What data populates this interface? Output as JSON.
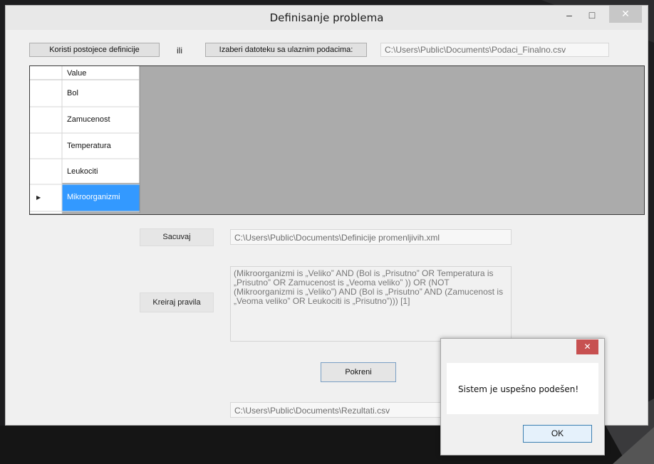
{
  "window": {
    "title": "Definisanje problema",
    "minimize_glyph": "–",
    "maximize_glyph": "□",
    "close_glyph": "✕"
  },
  "toolbar": {
    "use_existing_label": "Koristi postojece definicije",
    "or_label": "ili",
    "choose_file_label": "Izaberi datoteku sa ulaznim podacima:",
    "input_file_path": "C:\\Users\\Public\\Documents\\Podaci_Finalno.csv"
  },
  "grid": {
    "column_header": "Value",
    "current_row_glyph": "▶",
    "rows": [
      "Bol",
      "Zamucenost",
      "Temperatura",
      "Leukociti",
      "Mikroorganizmi"
    ],
    "selected_index": 4
  },
  "save": {
    "button_label": "Sacuvaj",
    "path": "C:\\Users\\Public\\Documents\\Definicije promenljivih.xml"
  },
  "rules": {
    "button_label": "Kreiraj pravila",
    "text": "(Mikroorganizmi is „Veliko” AND (Bol is „Prisutno” OR Temperatura is „Prisutno” OR Zamucenost is „Veoma veliko” )) OR (NOT (Mikroorganizmi is „Veliko”) AND (Bol is „Prisutno” AND (Zamucenost is „Veoma veliko”  OR Leukociti is „Prisutno”))) [1]"
  },
  "run": {
    "button_label": "Pokreni"
  },
  "results": {
    "path": "C:\\Users\\Public\\Documents\\Rezultati.csv"
  },
  "dialog": {
    "close_glyph": "✕",
    "message": "Sistem je uspešno podešen!",
    "ok_label": "OK"
  },
  "colors": {
    "selected_row": "#3399ff",
    "grid_background": "#ababab",
    "dialog_close": "#c75050"
  }
}
